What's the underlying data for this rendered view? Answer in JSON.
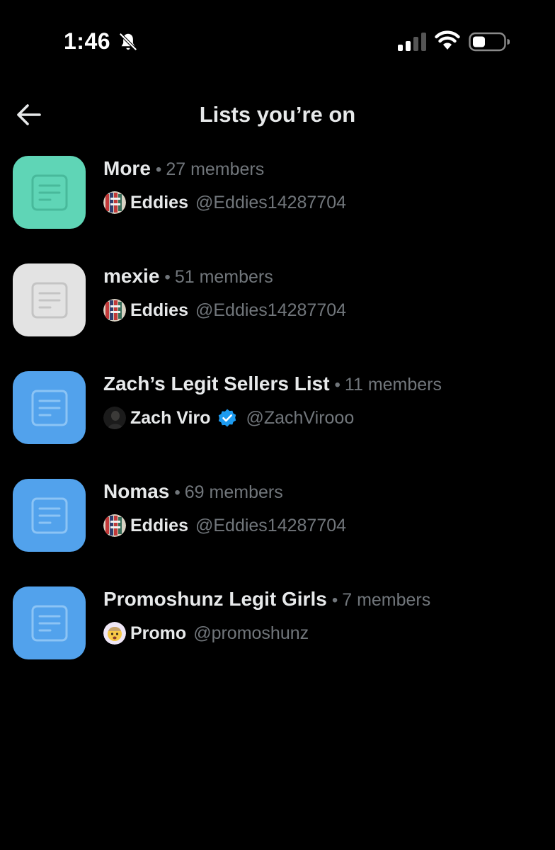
{
  "status_bar": {
    "time": "1:46",
    "icons": [
      "bell-slash-icon",
      "cellular-signal-icon",
      "wifi-icon",
      "battery-icon"
    ]
  },
  "header": {
    "back_icon": "arrow-left-icon",
    "title": "Lists you’re on"
  },
  "dot": "•",
  "lists": [
    {
      "name": "More",
      "members": "27 members",
      "thumb_color": "#5fd5b6",
      "icon_color": "#48b99b",
      "owner": {
        "name": "Eddies",
        "handle": "@Eddies14287704",
        "verified": false,
        "avatar": "eddies"
      }
    },
    {
      "name": "mexie",
      "members": "51 members",
      "thumb_color": "#e3e3e3",
      "icon_color": "#c4c4c4",
      "owner": {
        "name": "Eddies",
        "handle": "@Eddies14287704",
        "verified": false,
        "avatar": "eddies"
      }
    },
    {
      "name": "Zach’s Legit Sellers List",
      "members": "11 members",
      "thumb_color": "#52a2ec",
      "icon_color": "#8cc4f5",
      "owner": {
        "name": "Zach Viro",
        "handle": "@ZachVirooo",
        "verified": true,
        "avatar": "zach"
      }
    },
    {
      "name": "Nomas",
      "members": "69 members",
      "thumb_color": "#52a2ec",
      "icon_color": "#8cc4f5",
      "owner": {
        "name": "Eddies",
        "handle": "@Eddies14287704",
        "verified": false,
        "avatar": "eddies"
      }
    },
    {
      "name": "Promoshunz Legit Girls",
      "members": "7 members",
      "thumb_color": "#52a2ec",
      "icon_color": "#8cc4f5",
      "owner": {
        "name": "Promo",
        "handle": "@promoshunz",
        "verified": false,
        "avatar": "promo"
      }
    }
  ],
  "colors": {
    "background": "#000000",
    "text_primary": "#e7e9ea",
    "text_secondary": "#71767b",
    "verified_blue": "#1d9bf0"
  }
}
